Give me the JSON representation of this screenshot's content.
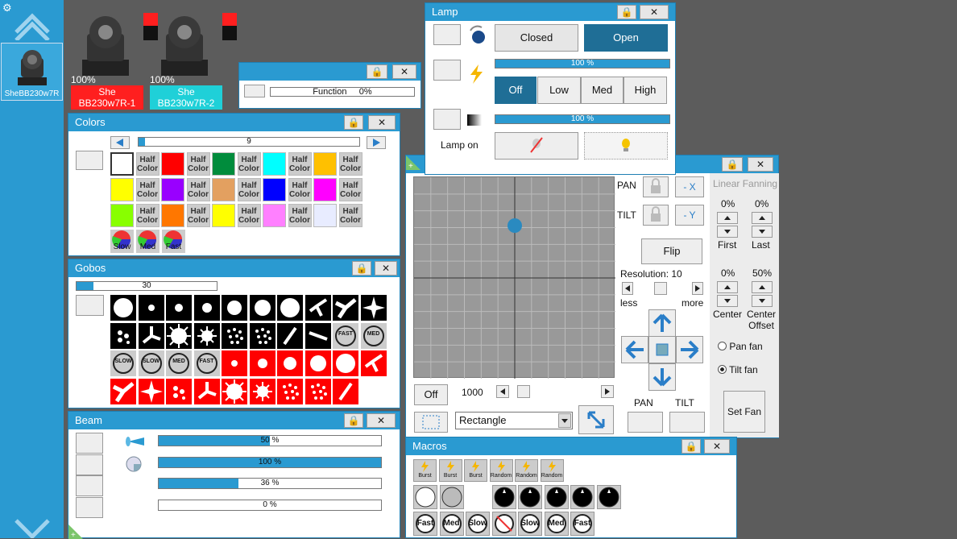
{
  "colors": {
    "accent": "#2a9ad1",
    "bg": "#5c5c5c",
    "fixture_red": "#ff1f1f",
    "fixture_cyan": "#1fd0d8",
    "gobo_red": "#ff0000"
  },
  "sidebar": {
    "gear": "⚙",
    "fixture_label": "SheBB230w7R"
  },
  "fixtures": [
    {
      "percent": "100%",
      "line1": "She",
      "line2": "BB230w7R-1"
    },
    {
      "percent": "100%",
      "line1": "She",
      "line2": "BB230w7R-2"
    }
  ],
  "function_panel": {
    "label": "Function",
    "value": "0%"
  },
  "lamp": {
    "title": "Lamp",
    "closed": "Closed",
    "open": "Open",
    "bar1": "100 %",
    "off": "Off",
    "low": "Low",
    "med": "Med",
    "high": "High",
    "bar2": "100 %",
    "lamp_on": "Lamp on",
    "bar1_level": 1.0,
    "bar2_level": 1.0
  },
  "colors_panel": {
    "title": "Colors",
    "slider_value": "9",
    "slider_level": 0.03,
    "half": "Half Color",
    "swatches": [
      "#ffffff",
      "half",
      "#ff0000",
      "half",
      "#008c3c",
      "half",
      "#00ffff",
      "half",
      "#ffc000",
      "half",
      "#ffff00",
      "half",
      "#9900ff",
      "half",
      "#e3a060",
      "half",
      "#0000ff",
      "half",
      "#ff00ff",
      "half",
      "#88ff00",
      "half",
      "#ff7700",
      "half",
      "#ffff00",
      "half",
      "#ff80ff",
      "half",
      "#e8ecff",
      "half"
    ],
    "speeds": [
      "Slow",
      "Med",
      "Fast"
    ]
  },
  "gobos": {
    "title": "Gobos",
    "slider_value": "30",
    "slider_level": 0.12,
    "labels": {
      "fast": "FAST",
      "med": "MED",
      "slow": "SLOW"
    }
  },
  "beam": {
    "title": "Beam",
    "rows": [
      {
        "text": "50 %",
        "level": 0.5
      },
      {
        "text": "100 %",
        "level": 1.0
      },
      {
        "text": "36 %",
        "level": 0.36
      },
      {
        "text": "0 %",
        "level": 0.0
      }
    ]
  },
  "pantilt": {
    "pan": "PAN",
    "tilt": "TILT",
    "minus_x": "- X",
    "minus_y": "- Y",
    "flip": "Flip",
    "resolution": "Resolution: 10",
    "less": "less",
    "more": "more",
    "off": "Off",
    "speed": "1000",
    "shape": "Rectangle",
    "pan_btn": "PAN",
    "tilt_btn": "TILT",
    "dot_x": 0.5,
    "dot_y": 0.24
  },
  "fanning": {
    "title": "Linear Fanning",
    "first_val": "0%",
    "last_val": "0%",
    "first": "First",
    "last": "Last",
    "center_val": "0%",
    "offset_val": "50%",
    "center": "Center",
    "center_offset_1": "Center",
    "center_offset_2": "Offset",
    "pan_fan": "Pan fan",
    "tilt_fan": "Tilt fan",
    "set_fan": "Set Fan"
  },
  "macros": {
    "title": "Macros",
    "row1": [
      "Burst",
      "Burst",
      "Burst",
      "Random",
      "Random",
      "Random"
    ],
    "row3": [
      "Fast",
      "Med",
      "Slow",
      "",
      "Slow",
      "Med",
      "Fast"
    ]
  },
  "close": "✕",
  "lock": "🔒"
}
